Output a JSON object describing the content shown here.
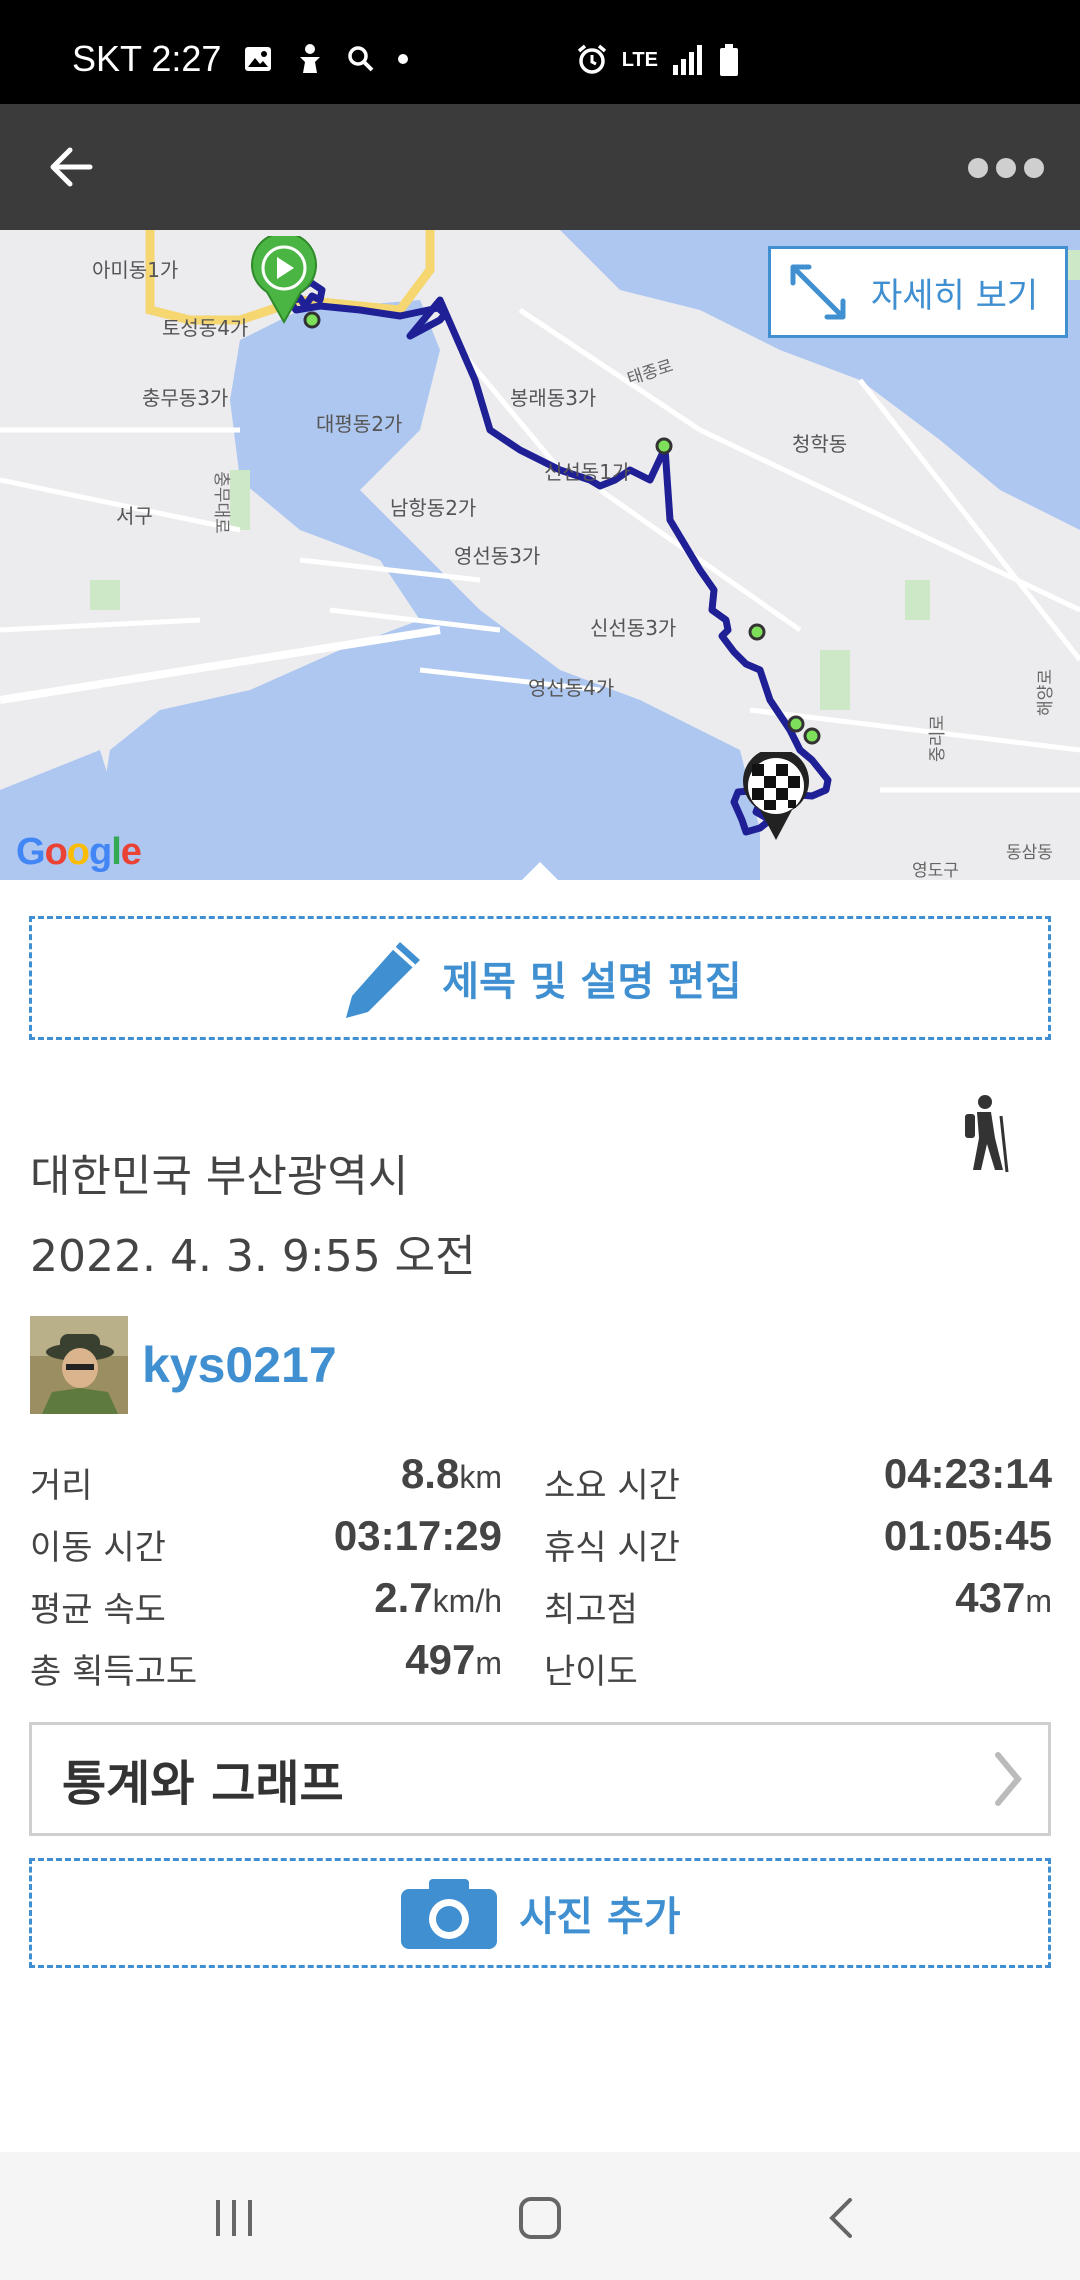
{
  "status_bar": {
    "carrier": "SKT",
    "time": "2:27",
    "network": "LTE"
  },
  "map": {
    "detail_button": "자세히 보기",
    "google": "Google",
    "labels": {
      "amidong": "아미동1가",
      "toseong": "토성동4가",
      "chungmu": "충무동3가",
      "seogu": "서구",
      "daepyeong": "대평동2가",
      "bongrae": "봉래동3가",
      "taejongro": "태종로",
      "cheonghak": "청학동",
      "sinseon1": "신선동1가",
      "namhang": "남항동2가",
      "yeongseon3": "영선동3가",
      "sinseon3": "신선동3가",
      "yeongseon4": "영선동4가",
      "jungniro": "중리로",
      "haeyangro": "해양로",
      "chungmudaero": "충무대로",
      "yeongdogu": "영도구",
      "dongsamdong": "동삼동"
    }
  },
  "edit_button": "제목 및 설명 편집",
  "location": "대한민국 부산광역시",
  "datetime": "2022. 4. 3. 9:55 오전",
  "user": {
    "name": "kys0217"
  },
  "stats": {
    "distance_label": "거리",
    "distance_value": "8.8",
    "distance_unit": "km",
    "duration_label": "소요 시간",
    "duration_value": "04:23:14",
    "moving_label": "이동 시간",
    "moving_value": "03:17:29",
    "rest_label": "휴식 시간",
    "rest_value": "01:05:45",
    "speed_label": "평균 속도",
    "speed_value": "2.7",
    "speed_unit": "km/h",
    "highest_label": "최고점",
    "highest_value": "437",
    "highest_unit": "m",
    "gain_label": "총 획득고도",
    "gain_value": "497",
    "gain_unit": "m",
    "difficulty_label": "난이도"
  },
  "stats_graph_button": "통계와 그래프",
  "photo_button": "사진 추가",
  "colors": {
    "accent": "#3f8fd1",
    "route": "#1f1f96",
    "appbar": "#3b3b3b"
  }
}
